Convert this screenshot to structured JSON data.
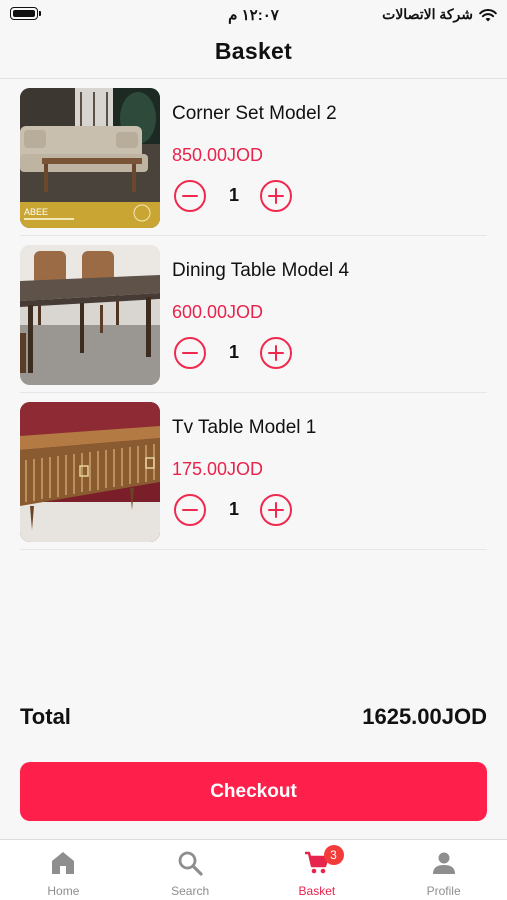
{
  "status_bar": {
    "time": "١٢:٠٧ م",
    "carrier": "شركة الاتصالات"
  },
  "header": {
    "title": "Basket"
  },
  "cart": {
    "items": [
      {
        "name": "Corner Set Model 2",
        "price": "850.00JOD",
        "quantity": "1",
        "image_icon": "sofa-photo",
        "thumb_text": "ABEE"
      },
      {
        "name": "Dining Table Model 4",
        "price": "600.00JOD",
        "quantity": "1",
        "image_icon": "dining-table-photo"
      },
      {
        "name": "Tv Table Model 1",
        "price": "175.00JOD",
        "quantity": "1",
        "image_icon": "tv-table-photo"
      }
    ]
  },
  "summary": {
    "total_label": "Total",
    "total_value": "1625.00JOD"
  },
  "checkout": {
    "label": "Checkout"
  },
  "tab_bar": {
    "tabs": [
      {
        "label": "Home",
        "icon": "home-icon"
      },
      {
        "label": "Search",
        "icon": "search-icon"
      },
      {
        "label": "Basket",
        "icon": "cart-icon",
        "badge": "3"
      },
      {
        "label": "Profile",
        "icon": "profile-icon"
      }
    ],
    "active_tab": "Basket"
  },
  "colors": {
    "accent": "#ff1f4b",
    "price": "#e8234c",
    "badge": "#f23b3b",
    "background": "#f7f7f7"
  }
}
